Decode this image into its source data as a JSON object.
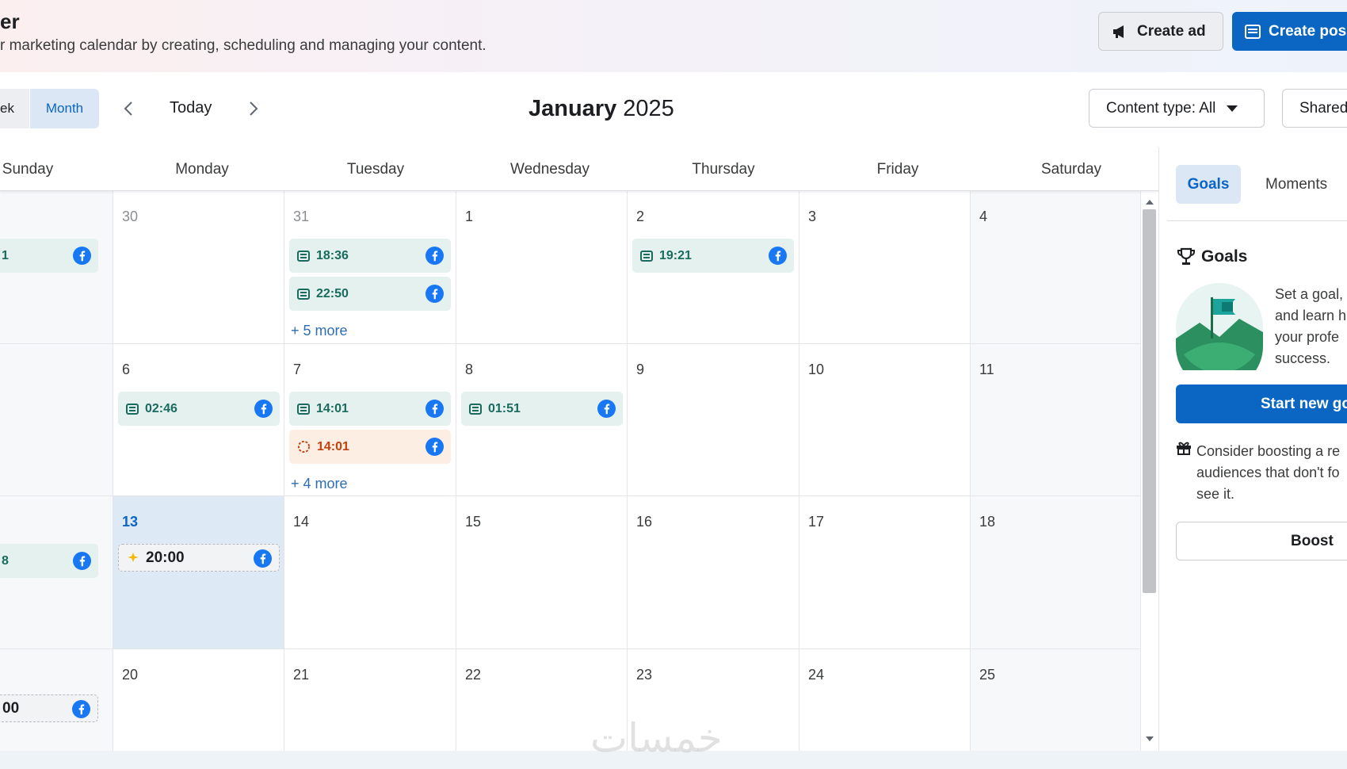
{
  "header": {
    "title": "er",
    "subtitle": "r marketing calendar by creating, scheduling and managing your content.",
    "create_ad": "Create ad",
    "create_post": "Create pos"
  },
  "toolbar": {
    "view_week": "ek",
    "view_month": "Month",
    "today": "Today",
    "month": "January",
    "year": "2025",
    "content_type": "Content type: All",
    "shared": "Shared"
  },
  "weekdays": [
    "Sunday",
    "Monday",
    "Tuesday",
    "Wednesday",
    "Thursday",
    "Friday",
    "Saturday"
  ],
  "days": {
    "w1": [
      "",
      "30",
      "31",
      "1",
      "2",
      "3",
      "4"
    ],
    "w2": [
      "",
      "6",
      "7",
      "8",
      "9",
      "10",
      "11"
    ],
    "w3": [
      "",
      "13",
      "14",
      "15",
      "16",
      "17",
      "18"
    ],
    "w4": [
      "",
      "20",
      "21",
      "22",
      "23",
      "24",
      "25"
    ]
  },
  "events": {
    "sun_w1": "1",
    "tue31_a": "18:36",
    "tue31_b": "22:50",
    "tue31_more": "+ 5 more",
    "thu2_a": "19:21",
    "mon6_a": "02:46",
    "tue7_a": "14:01",
    "tue7_b": "14:01",
    "tue7_more": "+ 4 more",
    "wed8_a": "01:51",
    "sun_w3": "8",
    "mon13_a": "20:00",
    "sun_w4": "00"
  },
  "sidebar": {
    "tab_goals": "Goals",
    "tab_moments": "Moments",
    "goals_title": "Goals",
    "goal_text": [
      "Set a goal,",
      "and learn h",
      "your profe",
      "success."
    ],
    "start_goal": "Start new go",
    "boost_note": [
      "Consider boosting a re",
      "audiences that don't fo",
      "see it."
    ],
    "boost": "Boost"
  },
  "watermark": "خمسات",
  "colors": {
    "accent": "#0a66c2",
    "facebook": "#1877f2",
    "event_bg": "#e4f1ef",
    "event_text": "#196b5e",
    "alert_bg": "#fdeee3",
    "alert_text": "#c2410c",
    "today_bg": "#dde9f5"
  },
  "icons": {
    "create_ad": "megaphone-icon",
    "create_post": "post-icon",
    "prev": "chevron-left-icon",
    "next": "chevron-right-icon",
    "dropdown": "caret-down-icon",
    "event": "post-icon",
    "platform": "facebook-icon",
    "alert": "spinner-icon",
    "story": "sparkle-icon",
    "goals": "trophy-icon",
    "boost_tip": "gift-icon"
  }
}
